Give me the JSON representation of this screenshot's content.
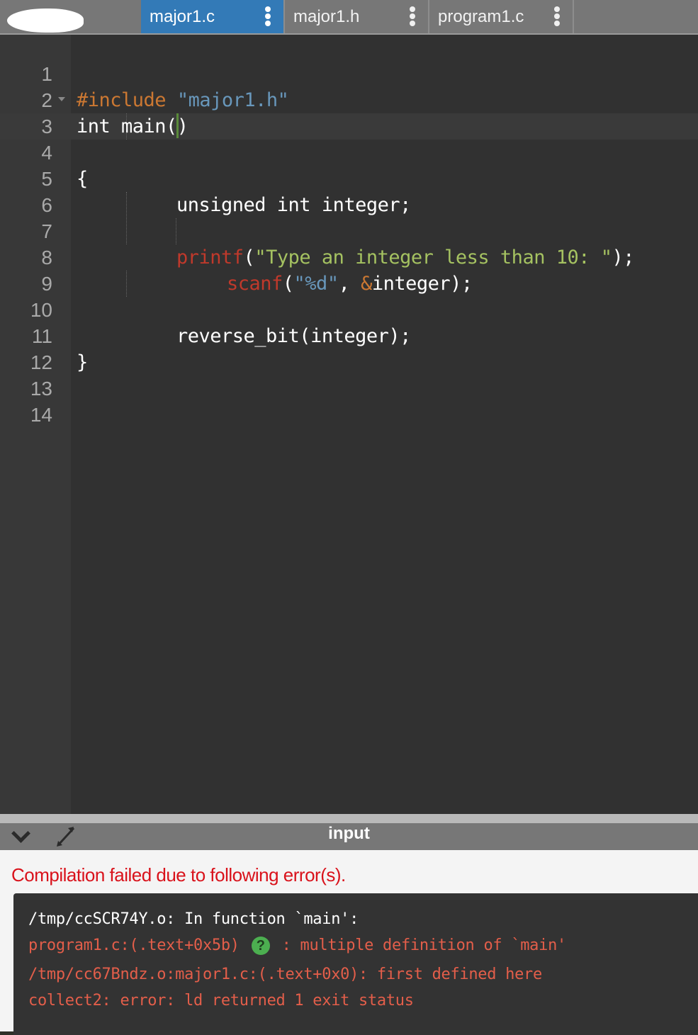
{
  "tabs": [
    {
      "label": "major1.c",
      "active": true
    },
    {
      "label": "major1.h",
      "active": false
    },
    {
      "label": "program1.c",
      "active": false
    }
  ],
  "editor": {
    "line_numbers": [
      "1",
      "2",
      "3",
      "4",
      "5",
      "6",
      "7",
      "8",
      "9",
      "10",
      "11",
      "12",
      "13",
      "14"
    ],
    "lines": {
      "l1_directive": "#include",
      "l1_string": "\"major1.h\"",
      "l2": "int main()",
      "l3": "{",
      "l5": "unsigned int integer;",
      "l7_fn": "printf",
      "l7_paren": "(",
      "l7_string": "\"Type an integer less than 10: \"",
      "l7_end": ");",
      "l8_fn": "scanf",
      "l8_paren": "(",
      "l8_string": "\"%d\"",
      "l8_comma": ", ",
      "l8_amp": "&",
      "l8_end": "integer);",
      "l10": "reverse_bit(integer);",
      "l11": "}"
    },
    "active_line": 4
  },
  "panel": {
    "title": "input",
    "collapse_icon": "chevron-down-icon",
    "expand_icon": "expand-arrows-icon"
  },
  "output": {
    "status": "Compilation failed due to following error(s).",
    "console": [
      {
        "text": "/tmp/ccSCR74Y.o: In function `main':",
        "kind": "info"
      },
      {
        "text_before": "program1.c:(.text+0x5b)",
        "help": "?",
        "text_after": ": multiple definition of `main'",
        "kind": "error"
      },
      {
        "text": "/tmp/cc67Bndz.o:major1.c:(.text+0x0): first defined here",
        "kind": "error"
      },
      {
        "text": "collect2: error: ld returned 1 exit status",
        "kind": "error"
      }
    ]
  },
  "colors": {
    "active_tab": "#337ab7",
    "error_text": "#d9121b",
    "console_error": "#e35e4a",
    "help_badge": "#4caf50"
  }
}
